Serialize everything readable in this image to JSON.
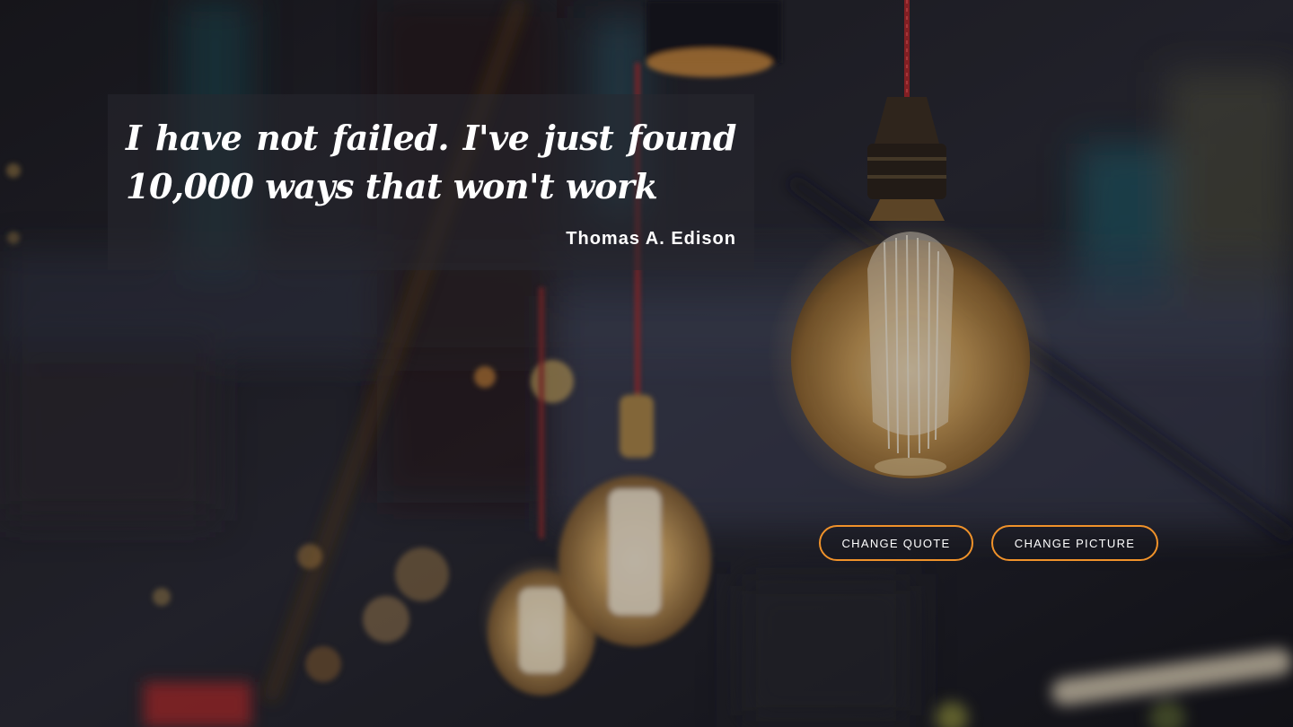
{
  "quote": {
    "text": "I have not failed. I've just found 10,000 ways that won't work",
    "author": "Thomas A. Edison"
  },
  "buttons": {
    "change_quote": "CHANGE QUOTE",
    "change_picture": "CHANGE PICTURE"
  },
  "colors": {
    "accent": "#f0922a",
    "overlay": "#282830"
  }
}
